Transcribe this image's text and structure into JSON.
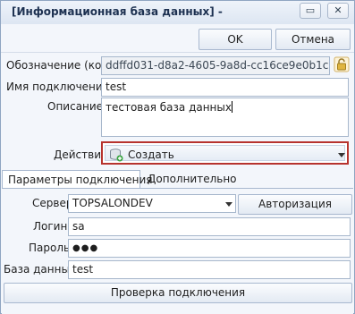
{
  "window": {
    "title": "[Информационная база данных] -",
    "minimize_glyph": "▭",
    "close_glyph": "✕"
  },
  "toolbar": {
    "ok_label": "OK",
    "cancel_label": "Отмена"
  },
  "form": {
    "code_label": "Обозначение (код):",
    "code_value": "ddffd031-d8a2-4605-9a8d-cc16ce9e0b1c",
    "connection_name_label": "Имя подключения:",
    "connection_name_value": "test",
    "description_label": "Описание:",
    "description_value": "тестовая база данных",
    "action_label": "Действие:",
    "action_value": "Создать"
  },
  "tabs": [
    {
      "label": "Параметры подключения",
      "active": true
    },
    {
      "label": "Дополнительно",
      "active": false
    }
  ],
  "connection": {
    "server_label": "Сервер:",
    "server_value": "TOPSALONDEV",
    "auth_button": "Авторизация Windows",
    "login_label": "Логин:",
    "login_value": "sa",
    "password_label": "Пароль:",
    "password_value": "●●●",
    "database_label": "База данных:",
    "database_value": "test",
    "check_button": "Проверка подключения"
  },
  "colors": {
    "highlight_border": "#b7332e",
    "window_border": "#8fa5c2",
    "accent_green": "#3aa543"
  },
  "icons": {
    "lock": "lock-icon",
    "create": "database-add-icon"
  }
}
